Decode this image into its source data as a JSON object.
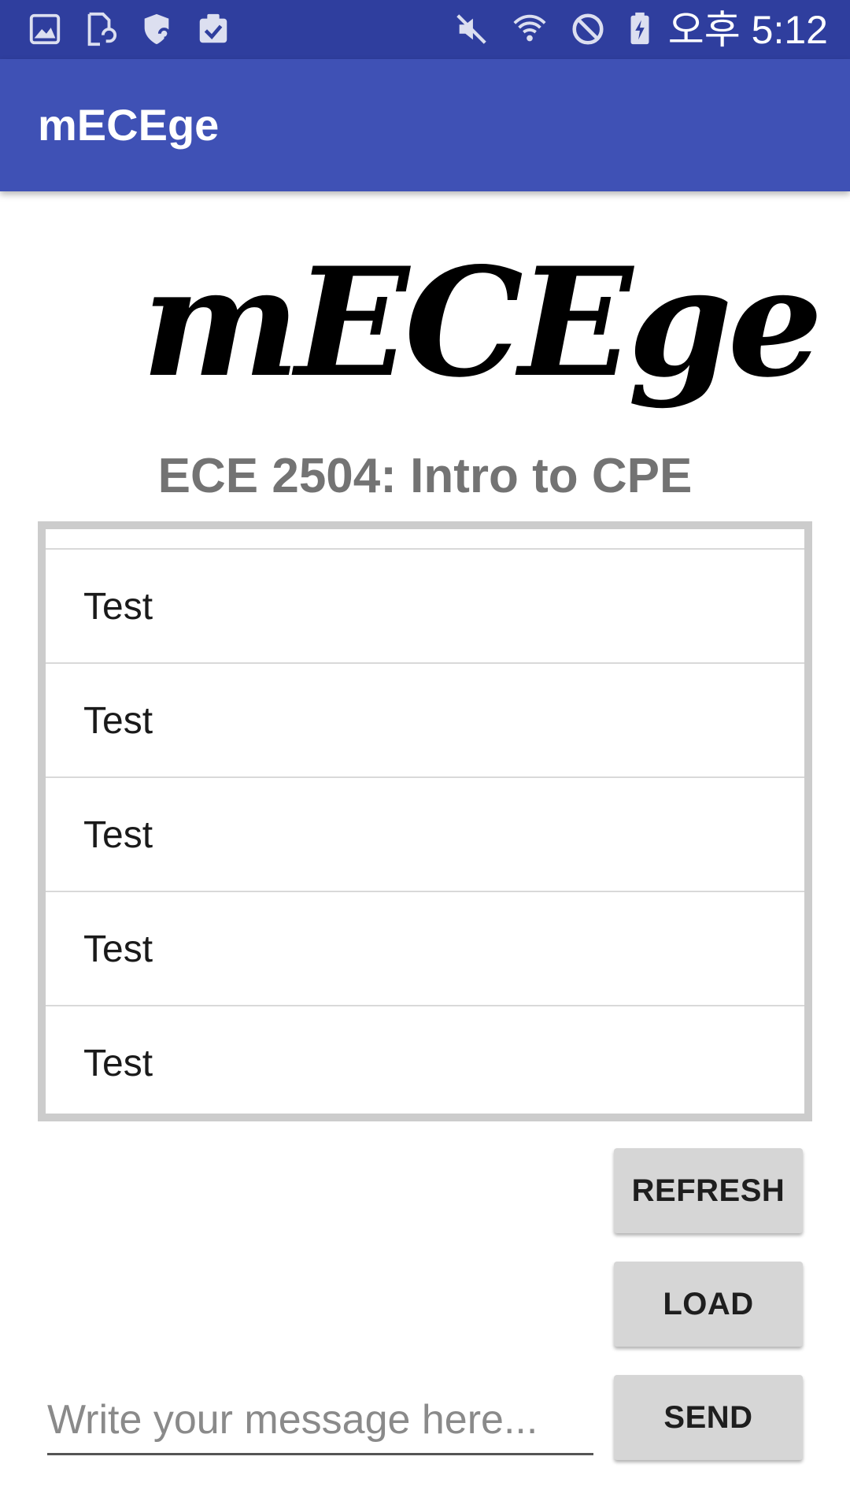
{
  "status_bar": {
    "time": "오후 5:12",
    "left_icons": [
      "gallery-icon",
      "file-sync-icon",
      "shield-sync-icon",
      "clipboard-check-icon"
    ],
    "right_icons": [
      "mute-icon",
      "wifi-icon",
      "do-not-disturb-icon",
      "battery-charging-icon"
    ]
  },
  "app_bar": {
    "title": "mECEge"
  },
  "logo": {
    "text": "mECEge"
  },
  "course": {
    "title": "ECE 2504: Intro to CPE"
  },
  "messages": [
    "Test",
    "Test",
    "Test",
    "Test",
    "Test"
  ],
  "buttons": {
    "refresh": "REFRESH",
    "load": "LOAD",
    "send": "SEND"
  },
  "input": {
    "placeholder": "Write your message here...",
    "value": ""
  },
  "colors": {
    "status_bar": "#2f3e9e",
    "app_bar": "#3f51b5",
    "button_bg": "#d6d6d6",
    "list_border": "#cccccc"
  }
}
